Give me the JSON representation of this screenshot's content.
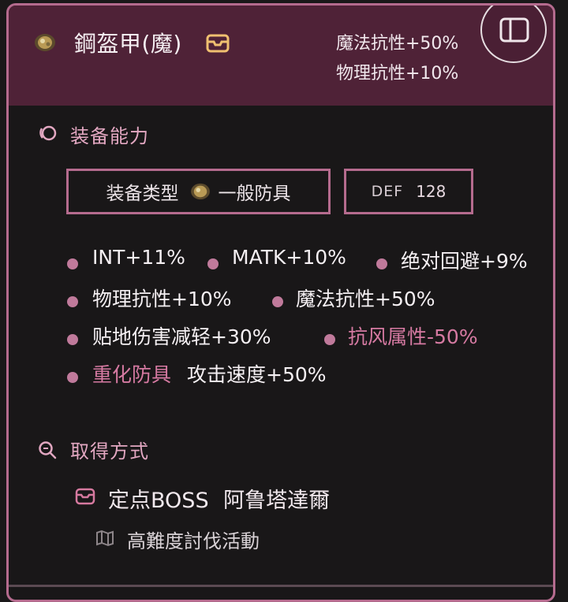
{
  "header": {
    "item_name": "鋼盔甲(魔)",
    "resist_magic": "魔法抗性+50%",
    "resist_physical": "物理抗性+10%",
    "item_icon": "armor-icon",
    "box_icon": "inbox-icon",
    "panel_icon": "sidebar-toggle-icon"
  },
  "equip": {
    "title": "装备能力",
    "title_icon": "orbit-icon",
    "type_label": "装备类型",
    "type_value": "一般防具",
    "def_label": "DEF",
    "def_value": "128",
    "stats": [
      [
        "INT+11%",
        "MATK+10%",
        "绝对回避+9%"
      ],
      [
        "物理抗性+10%",
        "魔法抗性+50%"
      ],
      [
        "贴地伤害减轻+30%",
        "抗风属性-50%"
      ]
    ],
    "heavy_label": "重化防具",
    "heavy_value": "攻击速度+50%"
  },
  "acquire": {
    "title": "取得方式",
    "title_icon": "search-icon",
    "source_label": "定点BOSS",
    "source_value": "阿鲁塔達爾",
    "source_icon": "inbox-icon",
    "note": "高難度討伐活動",
    "note_icon": "map-icon"
  },
  "colors": {
    "accent": "#b56b8e",
    "header_bg": "#4f2237",
    "bg": "#191718"
  }
}
